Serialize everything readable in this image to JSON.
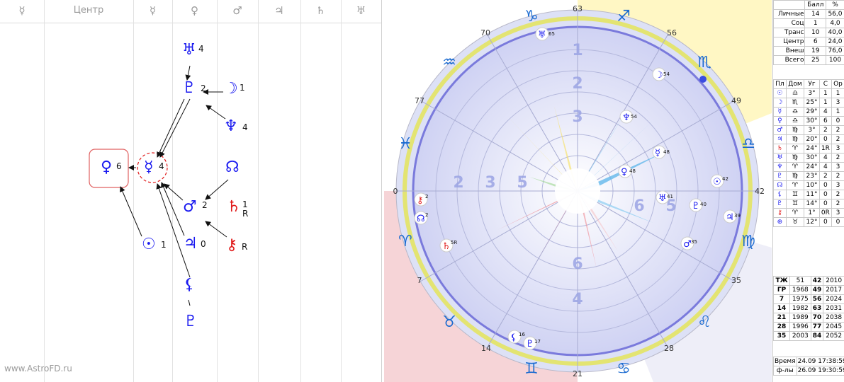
{
  "header": {
    "columns": [
      "☿",
      "Центр",
      "☿",
      "♀",
      "♂",
      "♃",
      "♄",
      "♅"
    ]
  },
  "watermark": "www.AstroFD.ru",
  "graph": {
    "nodes": [
      {
        "id": "uranus",
        "glyph": "♅",
        "num": "4"
      },
      {
        "id": "pluto",
        "glyph": "♇",
        "num": "2"
      },
      {
        "id": "moon",
        "glyph": "☽",
        "num": "1"
      },
      {
        "id": "neptune",
        "glyph": "♆",
        "num": "4"
      },
      {
        "id": "venus",
        "glyph": "♀",
        "num": "6"
      },
      {
        "id": "mercury",
        "glyph": "☿",
        "num": "4"
      },
      {
        "id": "node",
        "glyph": "☊",
        "num": ""
      },
      {
        "id": "mars",
        "glyph": "♂",
        "num": "2"
      },
      {
        "id": "saturn",
        "glyph": "♄",
        "num": "1",
        "sub": "R"
      },
      {
        "id": "sun",
        "glyph": "☉",
        "num": "1"
      },
      {
        "id": "jupiter",
        "glyph": "♃",
        "num": "0"
      },
      {
        "id": "chiron",
        "glyph": "⚷",
        "num": "R"
      },
      {
        "id": "lilith",
        "glyph": "⚸",
        "num": ""
      },
      {
        "id": "proserpina",
        "glyph": "♇",
        "num": ""
      }
    ]
  },
  "wheel": {
    "degree_marks": [
      "63",
      "56",
      "49",
      "42",
      "35",
      "28",
      "21",
      "14",
      "7",
      "0",
      "77",
      "70"
    ],
    "signs": [
      "♐",
      "♏",
      "♎",
      "♍",
      "♌",
      "♋",
      "♊",
      "♉",
      "♈",
      "♓",
      "♒",
      "♑"
    ],
    "planets": [
      {
        "glyph": "♅",
        "val": "65"
      },
      {
        "glyph": "☽",
        "val": "54"
      },
      {
        "glyph": "♆",
        "val": "54"
      },
      {
        "glyph": "☿",
        "val": "48"
      },
      {
        "glyph": "♀",
        "val": "48"
      },
      {
        "glyph": "☉",
        "val": "42"
      },
      {
        "glyph": "♅",
        "val": "41"
      },
      {
        "glyph": "♇",
        "val": "40"
      },
      {
        "glyph": "♃",
        "val": "39"
      },
      {
        "glyph": "♂",
        "val": "35"
      },
      {
        "glyph": "⚸",
        "val": "16"
      },
      {
        "glyph": "♇",
        "val": "17"
      },
      {
        "glyph": "⚷",
        "val": "2"
      },
      {
        "glyph": "☊",
        "val": "2"
      },
      {
        "glyph": "♄",
        "val": "5R"
      }
    ],
    "ring_digits": [
      "1",
      "2",
      "3",
      "4",
      "5",
      "6"
    ]
  },
  "summary": {
    "headers": [
      "",
      "Балл",
      "%"
    ],
    "rows": [
      [
        "Личные",
        "14",
        "56,0"
      ],
      [
        "Соц",
        "1",
        "4,0"
      ],
      [
        "Транс",
        "10",
        "40,0"
      ],
      [
        "Центр",
        "6",
        "24,0"
      ],
      [
        "Внеш",
        "19",
        "76,0"
      ],
      [
        "Всего",
        "25",
        "100"
      ]
    ]
  },
  "planets_table": {
    "headers": [
      "Пл",
      "Дом",
      "Уг",
      "С",
      "Ор"
    ],
    "rows": [
      [
        "☉",
        "♎",
        "3°",
        "1",
        "1"
      ],
      [
        "☽",
        "♏",
        "25°",
        "1",
        "3"
      ],
      [
        "☿",
        "♎",
        "29°",
        "4",
        "1"
      ],
      [
        "♀",
        "♎",
        "30°",
        "6",
        "0"
      ],
      [
        "♂",
        "♍",
        "3°",
        "2",
        "2"
      ],
      [
        "♃",
        "♍",
        "20°",
        "0",
        "2"
      ],
      [
        "♄",
        "♈",
        "24°",
        "1R",
        "3"
      ],
      [
        "♅",
        "♍",
        "30°",
        "4",
        "2"
      ],
      [
        "♆",
        "♈",
        "24°",
        "4",
        "3"
      ],
      [
        "♇",
        "♍",
        "23°",
        "2",
        "2"
      ],
      [
        "☊",
        "♈",
        "10°",
        "0",
        "3"
      ],
      [
        "⚸",
        "♊",
        "11°",
        "0",
        "2"
      ],
      [
        "♇",
        "♊",
        "14°",
        "0",
        "2"
      ],
      [
        "⚷",
        "♈",
        "1°",
        "0R",
        "3"
      ],
      [
        "⊕",
        "♉",
        "12°",
        "0",
        "0"
      ]
    ]
  },
  "years_table": {
    "rows": [
      [
        "ТЖ",
        "51",
        "42",
        "2010"
      ],
      [
        "ГР",
        "1968",
        "49",
        "2017"
      ],
      [
        "7",
        "1975",
        "56",
        "2024"
      ],
      [
        "14",
        "1982",
        "63",
        "2031"
      ],
      [
        "21",
        "1989",
        "70",
        "2038"
      ],
      [
        "28",
        "1996",
        "77",
        "2045"
      ],
      [
        "35",
        "2003",
        "84",
        "2052"
      ]
    ]
  },
  "footer": {
    "time_label": "Время",
    "time_value": "24.09 17:38:59",
    "phi_label": "ф-лы",
    "phi_value": "26.09 19:30:59"
  },
  "colors": {
    "planet_blue": "#1a1af0",
    "retro_red": "#e01818",
    "highlight": "#e06060"
  }
}
